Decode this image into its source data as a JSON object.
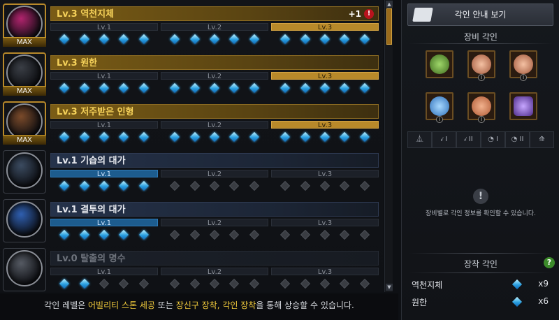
{
  "engravings": [
    {
      "title": "Lv.3 역천지체",
      "style": "gold",
      "max": true,
      "orb": "#b0246d",
      "active_level": 3,
      "gems_on": 15,
      "plus": "+1",
      "alert": "!"
    },
    {
      "title": "Lv.3 원한",
      "style": "gold",
      "max": true,
      "orb": "#3a3e45",
      "active_level": 3,
      "gems_on": 15
    },
    {
      "title": "Lv.3 저주받은 인형",
      "style": "gold",
      "max": true,
      "orb": "#7a4a2a",
      "active_level": 3,
      "gems_on": 15
    },
    {
      "title": "Lv.1 기습의 대가",
      "style": "blue",
      "max": false,
      "orb": "#3b4b60",
      "active_level": 1,
      "gems_on": 5
    },
    {
      "title": "Lv.1 결투의 대가",
      "style": "blue",
      "max": false,
      "orb": "#2f5fb0",
      "active_level": 1,
      "gems_on": 5
    },
    {
      "title": "Lv.0 탈출의 명수",
      "style": "dim",
      "max": false,
      "orb": "#555a63",
      "active_level": 0,
      "gems_on": 2
    }
  ],
  "level_labels": [
    "Lv.1",
    "Lv.2",
    "Lv.3"
  ],
  "max_label": "MAX",
  "hint": {
    "p1": "각인 레벨은 ",
    "h1": "어빌리티 스톤 세공",
    "p2": " 또는 ",
    "h2": "장신구 장착, 각인 장착",
    "p3": "을 통해 상승할 수 있습니다."
  },
  "right": {
    "guide_button": "각인 안내 보기",
    "equip_title": "장비 각인",
    "slot_tiers": [
      "",
      "I",
      "I",
      "I",
      "I",
      ""
    ],
    "tabs": [
      "⏅",
      "𝒾 I",
      "𝒾 II",
      "◔ I",
      "◔ II",
      "⟰"
    ],
    "empty_icon": "!",
    "empty_message": "장비별로 각인 정보를 확인할 수 있습니다.",
    "mounted_title": "장착 각인",
    "help": "?",
    "mounted": [
      {
        "name": "역천지체",
        "count": "x9"
      },
      {
        "name": "원한",
        "count": "x6"
      }
    ]
  },
  "colors": {
    "gold": "#f6d25a",
    "gem": "#2a9fe0",
    "alert": "#b8131d",
    "help": "#3c8a2a"
  }
}
